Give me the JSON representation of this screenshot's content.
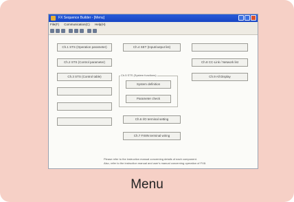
{
  "caption": "Menu",
  "window": {
    "title": "FX Sequence Builder - [Menu]"
  },
  "menubar": [
    "File(F)",
    "Communication(C)",
    "Help(H)"
  ],
  "toolbar": {
    "icons": [
      "new-icon",
      "open-icon",
      "save-icon",
      "cut-icon",
      "copy-icon",
      "paste-icon",
      "print-icon",
      "help-icon"
    ]
  },
  "buttons": {
    "ch1": "Ch.1 STS (Operation parameter)",
    "ch2": "Ch.2 STS (Control parameter)",
    "ch3": "Ch.3 STS (Control table)",
    "ch4": "Ch.4 SET (Input/output list)",
    "ch5_group": "Ch.5 STS (System functions)",
    "system_definition": "System definition",
    "parameter_check": "Parameter check",
    "ch6": "Ch.6 I/O terminal setting",
    "ch7": "Ch.7 FX8N terminal wiring",
    "ch8": "Ch.8 CC-Link / Network list",
    "ch9": "Ch.9 All Display",
    "empty": ""
  },
  "note": [
    "Please refer to the instruction manual concerning details of each component.",
    "Also, refer to the instruction manual and user's manual concerning operation of FX8."
  ],
  "colors": {
    "card": "#f6d0c6",
    "titlebar": "#1846c4",
    "close": "#d8502e"
  }
}
